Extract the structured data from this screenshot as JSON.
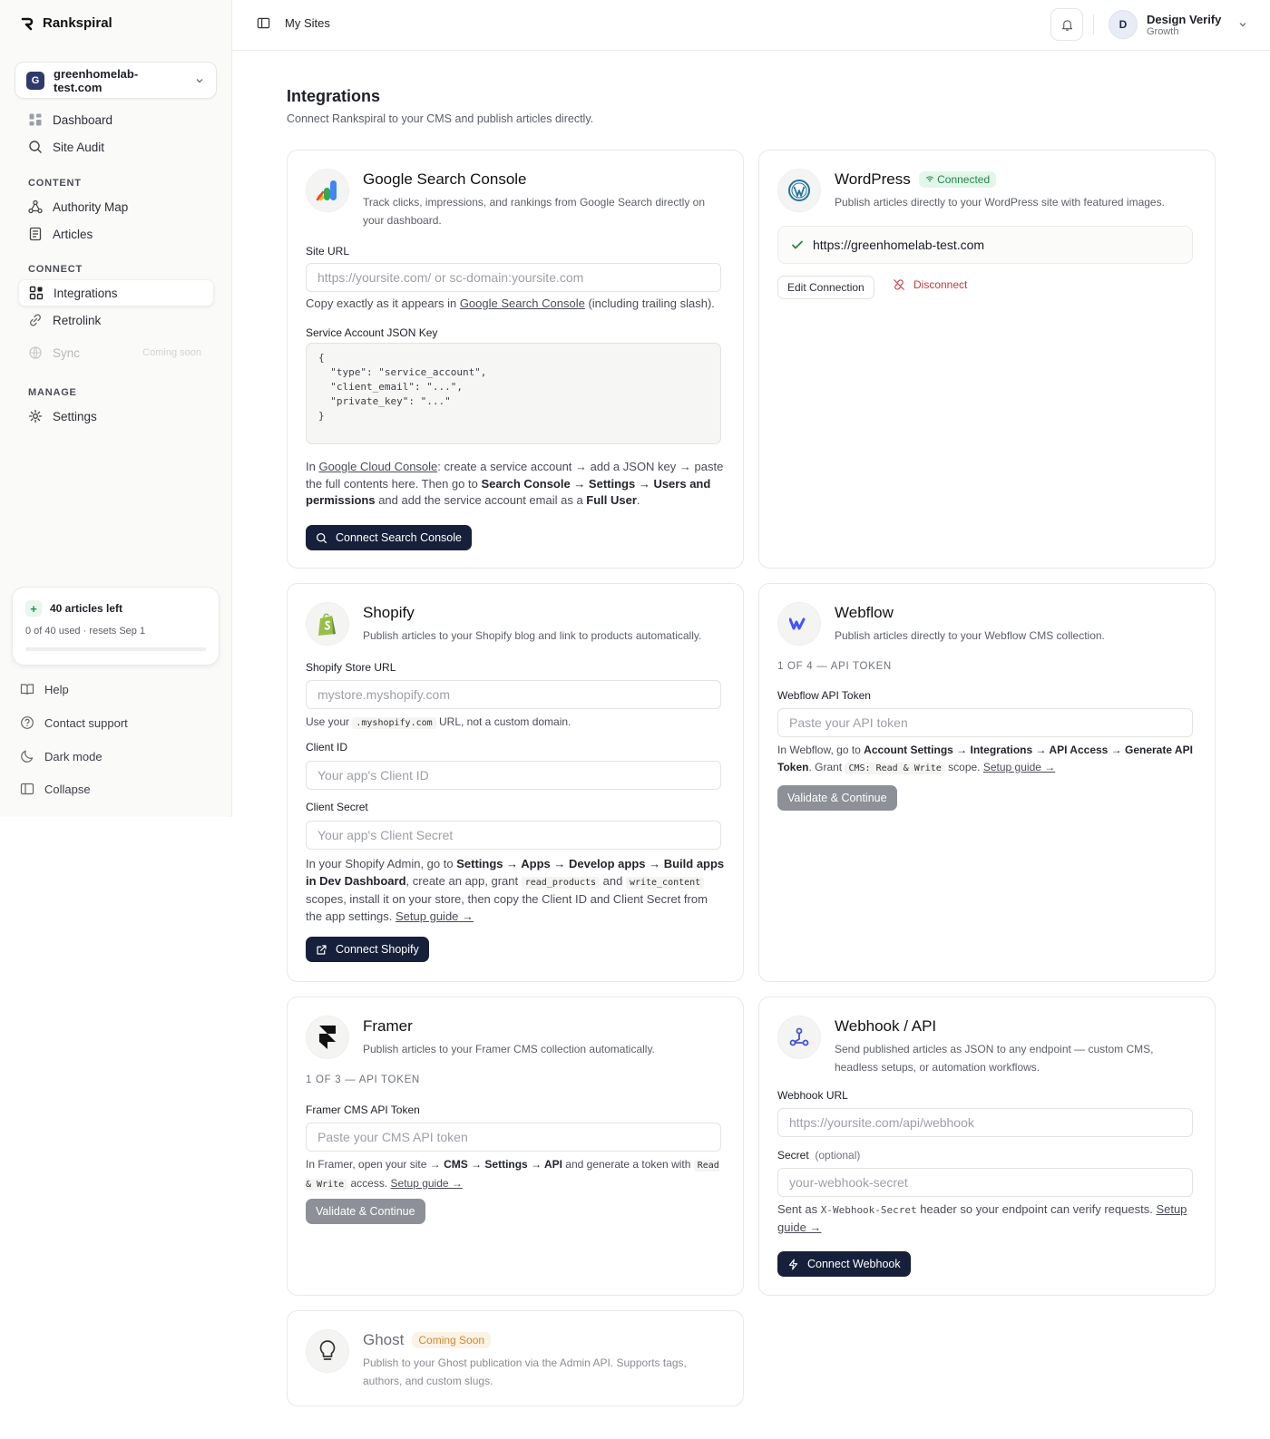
{
  "app": {
    "name": "Rankspiral"
  },
  "site_selector": {
    "initial": "G",
    "domain": "greenhomelab-test.com"
  },
  "nav": {
    "main": [
      {
        "label": "Dashboard",
        "icon": "grid-icon"
      },
      {
        "label": "Site Audit",
        "icon": "search-icon"
      }
    ],
    "content_header": "CONTENT",
    "content": [
      {
        "label": "Authority Map",
        "icon": "graph-icon"
      },
      {
        "label": "Articles",
        "icon": "document-icon"
      }
    ],
    "connect_header": "CONNECT",
    "connect": [
      {
        "label": "Integrations",
        "icon": "integrations-icon",
        "active": true
      },
      {
        "label": "Retrolink",
        "icon": "link-icon"
      },
      {
        "label": "Sync",
        "icon": "globe-icon",
        "badge": "Coming soon",
        "disabled": true
      }
    ],
    "manage_header": "MANAGE",
    "manage": [
      {
        "label": "Settings",
        "icon": "gear-icon"
      }
    ]
  },
  "quota": {
    "title": "40 articles left",
    "detail": "0 of 40 used · resets Sep 1",
    "used_fraction": 0
  },
  "footer_nav": [
    {
      "label": "Help",
      "icon": "book-icon"
    },
    {
      "label": "Contact support",
      "icon": "question-icon"
    },
    {
      "label": "Dark mode",
      "icon": "moon-icon"
    },
    {
      "label": "Collapse",
      "icon": "sidebar-icon"
    }
  ],
  "topbar": {
    "breadcrumb": "My Sites",
    "user": {
      "initial": "D",
      "name": "Design Verify",
      "plan": "Growth"
    }
  },
  "page": {
    "title": "Integrations",
    "subtitle": "Connect Rankspiral to your CMS and publish articles directly."
  },
  "gsc": {
    "title": "Google Search Console",
    "desc": "Track clicks, impressions, and rankings from Google Search directly on your dashboard.",
    "site_url_label": "Site URL",
    "site_url_placeholder": "https://yoursite.com/ or sc-domain:yoursite.com",
    "help1_a": "Copy exactly as it appears in ",
    "help1_link": "Google Search Console",
    "help1_b": " (including trailing slash).",
    "json_label": "Service Account JSON Key",
    "json_placeholder": "{\n  \"type\": \"service_account\",\n  \"client_email\": \"...\",\n  \"private_key\": \"...\"\n}",
    "help2_a": "In ",
    "help2_link": "Google Cloud Console",
    "help2_b": ": create a service account → add a JSON key → paste the full contents here. Then go to ",
    "help2_c": "Search Console → Settings → Users and permissions",
    "help2_d": " and add the service account email as a ",
    "help2_e": "Full User",
    "help2_f": ".",
    "button": "Connect Search Console"
  },
  "wordpress": {
    "title": "WordPress",
    "status": "Connected",
    "desc": "Publish articles directly to your WordPress site with featured images.",
    "url": "https://greenhomelab-test.com",
    "edit_button": "Edit Connection",
    "disconnect_button": "Disconnect"
  },
  "shopify": {
    "title": "Shopify",
    "desc": "Publish articles to your Shopify blog and link to products automatically.",
    "store_label": "Shopify Store URL",
    "store_placeholder": "mystore.myshopify.com",
    "store_help_a": "Use your ",
    "store_help_code": ".myshopify.com",
    "store_help_b": " URL, not a custom domain.",
    "client_id_label": "Client ID",
    "client_id_placeholder": "Your app's Client ID",
    "client_secret_label": "Client Secret",
    "client_secret_placeholder": "Your app's Client Secret",
    "help_a": "In your Shopify Admin, go to ",
    "help_b": "Settings → Apps → Develop apps → Build apps in Dev Dashboard",
    "help_c": ", create an app, grant ",
    "help_code1": "read_products",
    "help_d": " and ",
    "help_code2": "write_content",
    "help_e": " scopes, install it on your store, then copy the Client ID and Client Secret from the app settings. ",
    "help_link": "Setup guide →",
    "button": "Connect Shopify"
  },
  "webflow": {
    "title": "Webflow",
    "desc": "Publish articles directly to your Webflow CMS collection.",
    "step": "1 OF 4 — API TOKEN",
    "token_label": "Webflow API Token",
    "token_placeholder": "Paste your API token",
    "help_a": "In Webflow, go to ",
    "help_b": "Account Settings → Integrations → API Access → Generate API Token",
    "help_c": ". Grant ",
    "help_code": "CMS: Read & Write",
    "help_d": " scope. ",
    "help_link": "Setup guide →",
    "button": "Validate & Continue"
  },
  "framer": {
    "title": "Framer",
    "desc": "Publish articles to your Framer CMS collection automatically.",
    "step": "1 OF 3 — API TOKEN",
    "token_label": "Framer CMS API Token",
    "token_placeholder": "Paste your CMS API token",
    "help_a": "In Framer, open your site → ",
    "help_b": "CMS → Settings → API",
    "help_c": " and generate a token with ",
    "help_code": "Read & Write",
    "help_d": " access. ",
    "help_link": "Setup guide →",
    "button": "Validate & Continue"
  },
  "webhook": {
    "title": "Webhook / API",
    "desc": "Send published articles as JSON to any endpoint — custom CMS, headless setups, or automation workflows.",
    "url_label": "Webhook URL",
    "url_placeholder": "https://yoursite.com/api/webhook",
    "secret_label": "Secret",
    "secret_optional": "(optional)",
    "secret_placeholder": "your-webhook-secret",
    "help_a": "Sent as ",
    "help_code": "X-Webhook-Secret",
    "help_b": " header so your endpoint can verify requests. ",
    "help_link": "Setup guide →",
    "button": "Connect Webhook"
  },
  "ghost": {
    "title": "Ghost",
    "status": "Coming Soon",
    "desc": "Publish to your Ghost publication via the Admin API. Supports tags, authors, and custom slugs."
  },
  "colors": {
    "brand_dark": "#16203a",
    "connected": "#20874a",
    "danger": "#c33a3a",
    "coming_soon": "#d08a2b"
  }
}
